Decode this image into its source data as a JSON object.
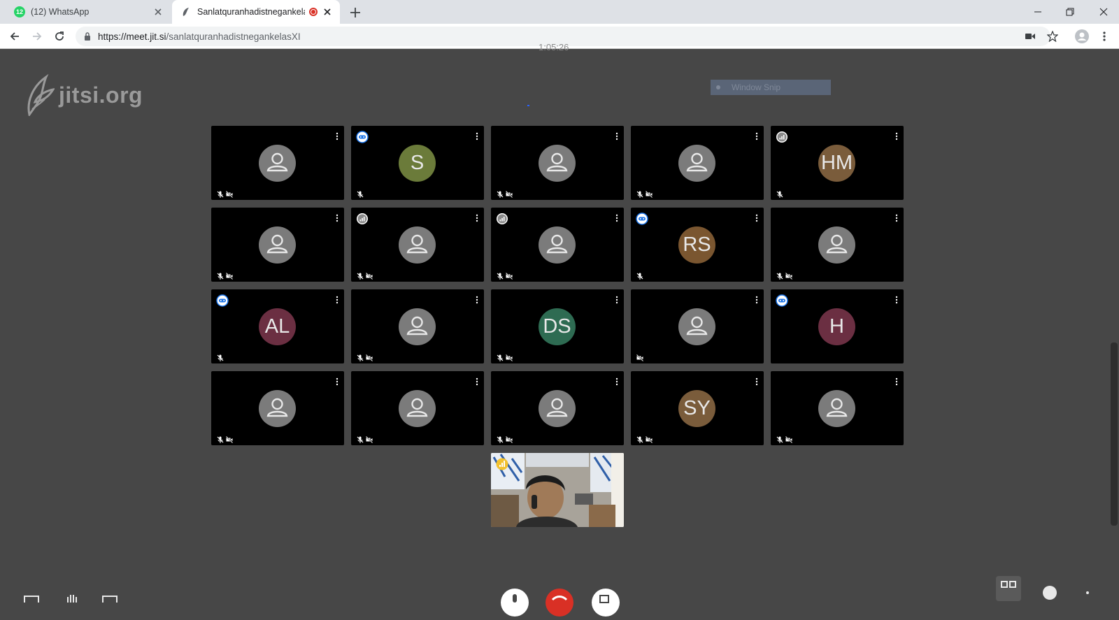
{
  "browser": {
    "tabs": [
      {
        "title": "(12) WhatsApp",
        "badge": "12",
        "active": false
      },
      {
        "title": "Sanlatquranhadistnegankelas",
        "active": true,
        "recording": true
      }
    ],
    "url": {
      "host": "https://meet.jit.si",
      "path": "/sanlatquranhadistnegankelasXI"
    }
  },
  "meeting": {
    "timer": "1:05:26",
    "logo_text": "jitsi.org",
    "overlay_label": "Window Snip",
    "participants": [
      {
        "initials": "",
        "color": "",
        "status": "none",
        "mic_muted": true,
        "video_off": true
      },
      {
        "initials": "S",
        "color": "#6b7b3a",
        "status": "mobile",
        "mic_muted": true,
        "video_off": false
      },
      {
        "initials": "",
        "color": "",
        "status": "none",
        "mic_muted": true,
        "video_off": true
      },
      {
        "initials": "",
        "color": "",
        "status": "none",
        "mic_muted": true,
        "video_off": true
      },
      {
        "initials": "HM",
        "color": "#7a5c3b",
        "status": "signal",
        "mic_muted": true,
        "video_off": false
      },
      {
        "initials": "",
        "color": "",
        "status": "none",
        "mic_muted": true,
        "video_off": true
      },
      {
        "initials": "",
        "color": "",
        "status": "signal",
        "mic_muted": true,
        "video_off": true
      },
      {
        "initials": "",
        "color": "",
        "status": "signal",
        "mic_muted": true,
        "video_off": true
      },
      {
        "initials": "RS",
        "color": "#7a5630",
        "status": "mobile",
        "mic_muted": true,
        "video_off": false
      },
      {
        "initials": "",
        "color": "",
        "status": "none",
        "mic_muted": true,
        "video_off": true
      },
      {
        "initials": "AL",
        "color": "#6b2f42",
        "status": "mobile",
        "mic_muted": true,
        "video_off": false
      },
      {
        "initials": "",
        "color": "",
        "status": "none",
        "mic_muted": true,
        "video_off": true
      },
      {
        "initials": "DS",
        "color": "#2e6b52",
        "status": "none",
        "mic_muted": true,
        "video_off": true
      },
      {
        "initials": "",
        "color": "",
        "status": "none",
        "mic_muted": false,
        "video_off": true
      },
      {
        "initials": "H",
        "color": "#6b2f42",
        "status": "mobile",
        "mic_muted": false,
        "video_off": false
      },
      {
        "initials": "",
        "color": "",
        "status": "none",
        "mic_muted": true,
        "video_off": true
      },
      {
        "initials": "",
        "color": "",
        "status": "none",
        "mic_muted": true,
        "video_off": true
      },
      {
        "initials": "",
        "color": "",
        "status": "none",
        "mic_muted": true,
        "video_off": true
      },
      {
        "initials": "SY",
        "color": "#7a5c3b",
        "status": "none",
        "mic_muted": true,
        "video_off": true
      },
      {
        "initials": "",
        "color": "",
        "status": "none",
        "mic_muted": true,
        "video_off": true
      }
    ]
  },
  "colors": {
    "background": "#474747",
    "tile": "#000000",
    "hangup": "#d93025",
    "status_blue": "#1a73e8",
    "status_gray": "#8a8a8a",
    "status_gold": "#f2c12e"
  },
  "icons": {
    "mic_off": "mic-off-icon",
    "video_off": "video-off-icon",
    "menu": "more-vert-icon",
    "mobile": "mobile-status-icon",
    "signal": "connection-signal-icon"
  }
}
